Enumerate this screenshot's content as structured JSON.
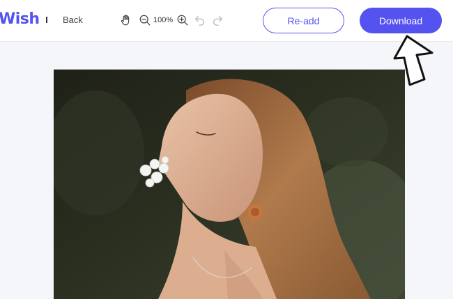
{
  "header": {
    "logo_text": "Wish",
    "back_label": "Back",
    "zoom_level": "100%",
    "readd_label": "Re-add",
    "download_label": "Download"
  },
  "icons": {
    "hand": "hand-icon",
    "zoom_out": "zoom-out-icon",
    "zoom_in": "zoom-in-icon",
    "undo": "undo-icon",
    "redo": "redo-icon",
    "annotation": "hand-drawn-arrow"
  },
  "colors": {
    "accent": "#5553f0",
    "canvas_background": "#f5f6fa"
  }
}
